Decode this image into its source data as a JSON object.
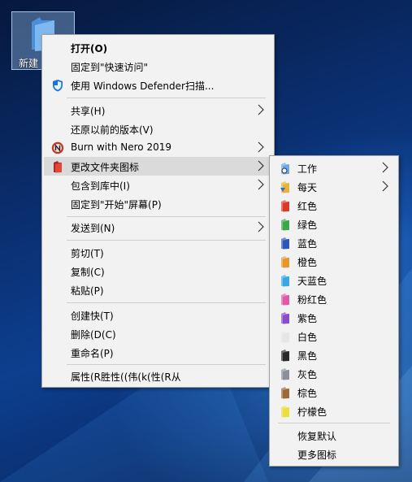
{
  "desktop": {
    "icon_label": "新建"
  },
  "context_menu": {
    "items": [
      {
        "label": "打开(O)",
        "bold": true
      },
      {
        "label": "固定到\"快速访问\""
      },
      {
        "label": "使用 Windows Defender扫描...",
        "icon": "defender-shield-icon"
      },
      {
        "label": "共享(H)",
        "submenu": true
      },
      {
        "label": "还原以前的版本(V)"
      },
      {
        "label": "Burn with Nero 2019",
        "icon": "nero-icon",
        "submenu": true
      },
      {
        "label": "更改文件夹图标",
        "icon": "red-folder-icon",
        "submenu": true,
        "highlighted": true
      },
      {
        "label": "包含到库中(I)",
        "submenu": true
      },
      {
        "label": "固定到\"开始\"屏幕(P)"
      },
      {
        "label": "发送到(N)",
        "submenu": true
      },
      {
        "label": "剪切(T)"
      },
      {
        "label": "复制(C)"
      },
      {
        "label": "粘贴(P)"
      },
      {
        "label": "创建快(T)"
      },
      {
        "label": "删除(D(C)"
      },
      {
        "label": "重命名(P)"
      },
      {
        "label": "属性(R胜性((伟(k(性(R从"
      }
    ]
  },
  "submenu": {
    "items": [
      {
        "label": "工作",
        "color": "#6aa7e8",
        "submenu": true
      },
      {
        "label": "每天",
        "color": "#e8b33c",
        "submenu": true
      },
      {
        "label": "红色",
        "color": "#d93a2c"
      },
      {
        "label": "绿色",
        "color": "#3aa84a"
      },
      {
        "label": "蓝色",
        "color": "#2f55b8"
      },
      {
        "label": "橙色",
        "color": "#e8962c"
      },
      {
        "label": "天蓝色",
        "color": "#39a7e0"
      },
      {
        "label": "粉红色",
        "color": "#e05aa8"
      },
      {
        "label": "紫色",
        "color": "#8a4cc8"
      },
      {
        "label": "白色",
        "color": "#e6e6e6"
      },
      {
        "label": "黑色",
        "color": "#2a2a2a"
      },
      {
        "label": "灰色",
        "color": "#8a8f98"
      },
      {
        "label": "棕色",
        "color": "#9a6a3c"
      },
      {
        "label": "柠檬色",
        "color": "#e8e03c"
      },
      {
        "label": "恢复默认"
      },
      {
        "label": "更多图标"
      }
    ]
  }
}
